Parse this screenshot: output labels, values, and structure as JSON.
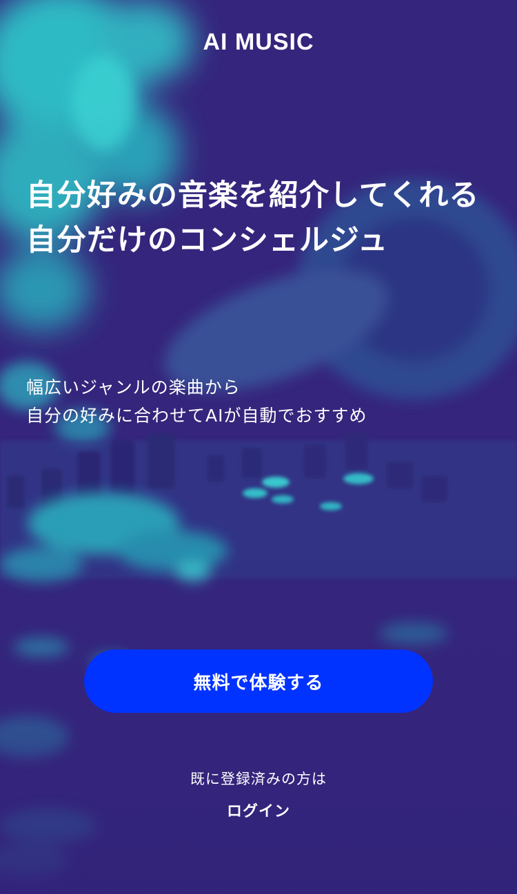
{
  "app": {
    "logo_text": "AI MUSIC"
  },
  "hero": {
    "headline_line1": "自分好みの音楽を紹介してくれる",
    "headline_line2": "自分だけのコンシェルジュ",
    "lead_line1": "幅広いジャンルの楽曲から",
    "lead_line2": "自分の好みに合わせてAIが自動でおすすめ",
    "background_image": "dj-mixer-photo-duotone"
  },
  "actions": {
    "cta_label": "無料で体験する",
    "already_registered_text": "既に登録済みの方は",
    "login_label": "ログイン"
  },
  "colors": {
    "background": "#34247b",
    "accent_teal": "#2fc3c9",
    "cta_blue": "#0033ff",
    "text": "#ffffff"
  }
}
